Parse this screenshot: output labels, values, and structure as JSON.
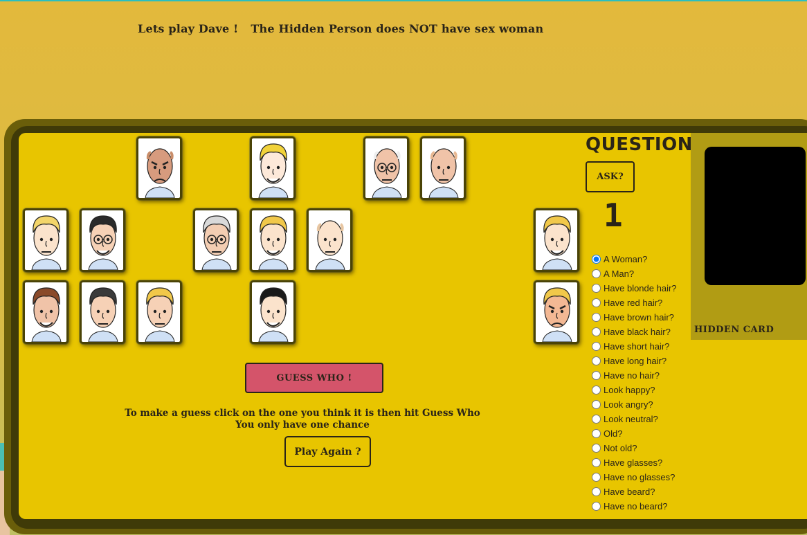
{
  "status": {
    "prefix": "Lets play Dave !",
    "message": "The Hidden Person does NOT have sex woman"
  },
  "cards": [
    {
      "id": "c1",
      "row": 0,
      "col": 2,
      "hair": "#c98d6a",
      "skin": "#d79b7e",
      "bald": true,
      "mood": "angry",
      "glasses": false
    },
    {
      "id": "c2",
      "row": 0,
      "col": 4,
      "hair": "#f1d23a",
      "skin": "#fde9d9",
      "bald": false,
      "mood": "happy",
      "glasses": false
    },
    {
      "id": "c3",
      "row": 0,
      "col": 6,
      "hair": "#eeeeee",
      "skin": "#f0c3a8",
      "bald": true,
      "mood": "neutral",
      "glasses": true
    },
    {
      "id": "c4",
      "row": 0,
      "col": 7,
      "hair": "#e8b892",
      "skin": "#f0c3a8",
      "bald": true,
      "mood": "neutral",
      "glasses": false
    },
    {
      "id": "c5",
      "row": 1,
      "col": 0,
      "hair": "#f3d56a",
      "skin": "#fbe3cc",
      "bald": false,
      "mood": "neutral",
      "glasses": false
    },
    {
      "id": "c6",
      "row": 1,
      "col": 1,
      "hair": "#2a2a2a",
      "skin": "#f6d1b6",
      "bald": false,
      "mood": "happy",
      "glasses": true
    },
    {
      "id": "c7",
      "row": 1,
      "col": 3,
      "hair": "#d9d9d9",
      "skin": "#f3cdb2",
      "bald": false,
      "mood": "neutral",
      "glasses": true
    },
    {
      "id": "c8",
      "row": 1,
      "col": 4,
      "hair": "#f1c84a",
      "skin": "#fbe3cc",
      "bald": false,
      "mood": "happy",
      "glasses": false
    },
    {
      "id": "c9",
      "row": 1,
      "col": 5,
      "hair": "#e8c6a2",
      "skin": "#fbe3cc",
      "bald": true,
      "mood": "neutral",
      "glasses": false
    },
    {
      "id": "c10",
      "row": 1,
      "col": 9,
      "hair": "#f1c84a",
      "skin": "#fbe3cc",
      "bald": false,
      "mood": "happy",
      "glasses": false
    },
    {
      "id": "c11",
      "row": 2,
      "col": 0,
      "hair": "#8a4a2a",
      "skin": "#f0c3a8",
      "bald": false,
      "mood": "happy",
      "glasses": false
    },
    {
      "id": "c12",
      "row": 2,
      "col": 1,
      "hair": "#3a3a3a",
      "skin": "#f6d1b6",
      "bald": false,
      "mood": "neutral",
      "glasses": false
    },
    {
      "id": "c13",
      "row": 2,
      "col": 2,
      "hair": "#f1c84a",
      "skin": "#f6d1b6",
      "bald": false,
      "mood": "neutral",
      "glasses": false
    },
    {
      "id": "c14",
      "row": 2,
      "col": 4,
      "hair": "#1a1a1a",
      "skin": "#fbe3cc",
      "bald": false,
      "mood": "happy",
      "glasses": false
    },
    {
      "id": "c15",
      "row": 2,
      "col": 9,
      "hair": "#f1c84a",
      "skin": "#f3b894",
      "bald": false,
      "mood": "angry",
      "glasses": false
    }
  ],
  "guess_button": "GUESS WHO !",
  "instructions": {
    "line1": "To make a guess click on the one you think it is then hit Guess Who",
    "line2": "You only have one chance"
  },
  "play_again_button": "Play Again ?",
  "questions_title": "QUESTIONS",
  "ask_button": "ASK?",
  "questions_asked": "1",
  "questions": [
    {
      "label": "A Woman?",
      "checked": true
    },
    {
      "label": "A Man?",
      "checked": false
    },
    {
      "label": "Have blonde hair?",
      "checked": false
    },
    {
      "label": "Have red hair?",
      "checked": false
    },
    {
      "label": "Have brown hair?",
      "checked": false
    },
    {
      "label": "Have black hair?",
      "checked": false
    },
    {
      "label": "Have short hair?",
      "checked": false
    },
    {
      "label": "Have long hair?",
      "checked": false
    },
    {
      "label": "Have no hair?",
      "checked": false
    },
    {
      "label": "Look happy?",
      "checked": false
    },
    {
      "label": "Look angry?",
      "checked": false
    },
    {
      "label": "Look neutral?",
      "checked": false
    },
    {
      "label": "Old?",
      "checked": false
    },
    {
      "label": "Not old?",
      "checked": false
    },
    {
      "label": "Have glasses?",
      "checked": false
    },
    {
      "label": "Have no glasses?",
      "checked": false
    },
    {
      "label": "Have beard?",
      "checked": false
    },
    {
      "label": "Have no beard?",
      "checked": false
    }
  ],
  "hidden_card_label": "HIDDEN CARD",
  "colors": {
    "board": "#e8c500",
    "guess_button": "#d4546a",
    "hidden_panel": "#b19c14"
  }
}
